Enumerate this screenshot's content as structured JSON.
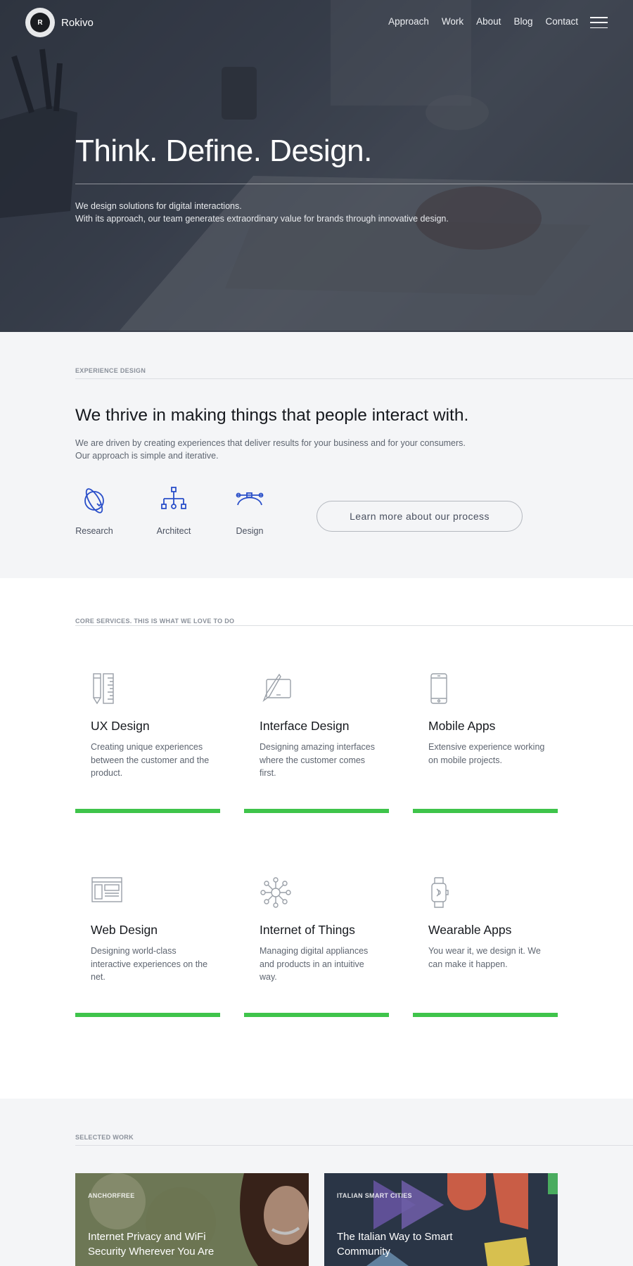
{
  "nav": {
    "logo_letter": "R",
    "brand": "Rokivo",
    "links": [
      "Approach",
      "Work",
      "About",
      "Blog",
      "Contact"
    ]
  },
  "hero": {
    "title": "Think. Define. Design.",
    "line1": "We design solutions for digital interactions.",
    "line2": "With its approach, our team generates extraordinary value for brands through innovative design."
  },
  "experience": {
    "label": "EXPERIENCE DESIGN",
    "title": "We thrive in making things that people interact with.",
    "desc1": "We are driven by creating experiences that deliver results for your business and for your consumers.",
    "desc2": "Our approach is simple and iterative.",
    "steps": [
      {
        "label": "Research",
        "icon": "research-icon"
      },
      {
        "label": "Architect",
        "icon": "architect-icon"
      },
      {
        "label": "Design",
        "icon": "design-icon"
      }
    ],
    "button": "Learn more about our process"
  },
  "services": {
    "label": "CORE SERVICES. THIS IS WHAT WE LOVE TO DO",
    "items": [
      {
        "title": "UX Design",
        "desc": "Creating unique experiences between the customer and the product.",
        "icon": "pencil-ruler-icon"
      },
      {
        "title": "Interface Design",
        "desc": "Designing amazing interfaces where the customer comes first.",
        "icon": "tablet-brush-icon"
      },
      {
        "title": "Mobile Apps",
        "desc": "Extensive experience working on mobile projects.",
        "icon": "smartphone-icon"
      },
      {
        "title": "Web Design",
        "desc": "Designing world-class interactive experiences on the net.",
        "icon": "browser-window-icon"
      },
      {
        "title": "Internet of Things",
        "desc": "Managing digital appliances and products in an intuitive way.",
        "icon": "iot-network-icon"
      },
      {
        "title": "Wearable Apps",
        "desc": "You wear it, we design it. We can make it happen.",
        "icon": "smartwatch-icon"
      }
    ]
  },
  "work": {
    "label": "SELECTED WORK",
    "items": [
      {
        "kicker": "ANCHORFREE",
        "title": "Internet Privacy and WiFi Security Wherever You Are"
      },
      {
        "kicker": "ITALIAN SMART CITIES",
        "title": "The Italian Way to Smart Community"
      }
    ]
  },
  "colors": {
    "accent_green": "#3fc44b",
    "icon_blue": "#2a4fc9",
    "page_bg": "#f4f5f7",
    "text_dark": "#16191e"
  }
}
